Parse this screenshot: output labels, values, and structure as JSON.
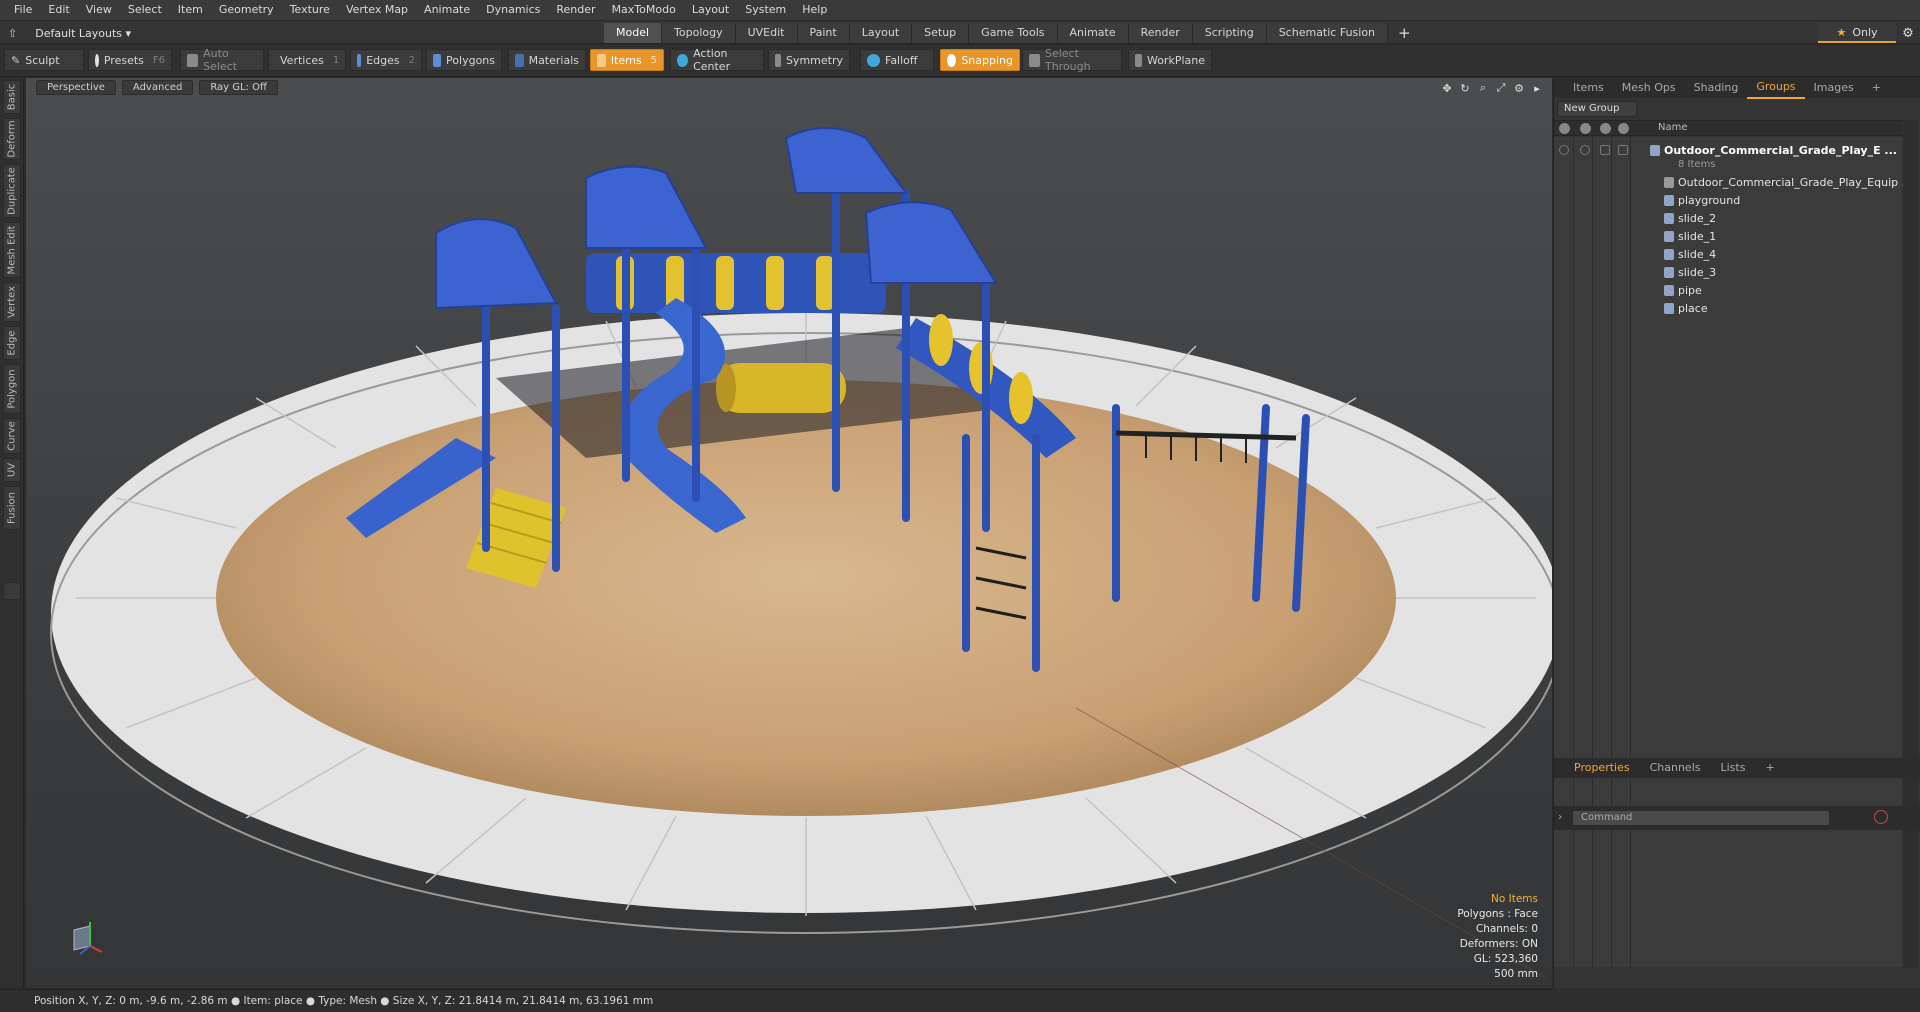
{
  "menu": [
    "File",
    "Edit",
    "View",
    "Select",
    "Item",
    "Geometry",
    "Texture",
    "Vertex Map",
    "Animate",
    "Dynamics",
    "Render",
    "MaxToModo",
    "Layout",
    "System",
    "Help"
  ],
  "layout_dropdown": "Default Layouts",
  "mode_tabs": [
    "Model",
    "Topology",
    "UVEdit",
    "Paint",
    "Layout",
    "Setup",
    "Game Tools",
    "Animate",
    "Render",
    "Scripting",
    "Schematic Fusion"
  ],
  "active_mode_tab": "Model",
  "only_label": "Only",
  "toolbar": {
    "sculpt": "Sculpt",
    "presets": "Presets",
    "presets_key": "F6",
    "auto_select": "Auto Select",
    "vertices": "Vertices",
    "vertices_count": "1",
    "edges": "Edges",
    "edges_count": "2",
    "polygons": "Polygons",
    "materials": "Materials",
    "items": "Items",
    "items_count": "5",
    "action_center": "Action Center",
    "symmetry": "Symmetry",
    "falloff": "Falloff",
    "snapping": "Snapping",
    "select_through": "Select Through",
    "workplane": "WorkPlane"
  },
  "left_tabs": [
    "Basic",
    "Deform",
    "Duplicate",
    "Mesh Edit",
    "Vertex",
    "Edge",
    "Polygon",
    "Curve",
    "UV",
    "Fusion"
  ],
  "viewport": {
    "view_label": "Perspective",
    "shading_label": "Advanced",
    "raygl_label": "Ray GL: Off",
    "info": {
      "selection": "No Items",
      "polygons": "Polygons : Face",
      "channels": "Channels: 0",
      "deformers": "Deformers: ON",
      "gl": "GL: 523,360",
      "grid": "500 mm"
    }
  },
  "right_panel": {
    "tabs": [
      "Items",
      "Mesh Ops",
      "Shading",
      "Groups",
      "Images"
    ],
    "active_tab": "Groups",
    "new_group": "New Group",
    "name_col": "Name",
    "group_name": "Outdoor_Commercial_Grade_Play_E ...",
    "group_count": "8 Items",
    "children": [
      "Outdoor_Commercial_Grade_Play_Equip ...",
      "playground",
      "slide_2",
      "slide_1",
      "slide_4",
      "slide_3",
      "pipe",
      "place"
    ],
    "bottom_tabs": [
      "Properties",
      "Channels",
      "Lists"
    ],
    "active_bottom_tab": "Properties",
    "command_placeholder": "Command"
  },
  "status": "Position X, Y, Z:   0 m, -9.6 m, -2.86 m ●  Item:  place ●  Type:  Mesh ●  Size X, Y, Z:   21.8414 m, 21.8414 m, 63.1961 mm"
}
